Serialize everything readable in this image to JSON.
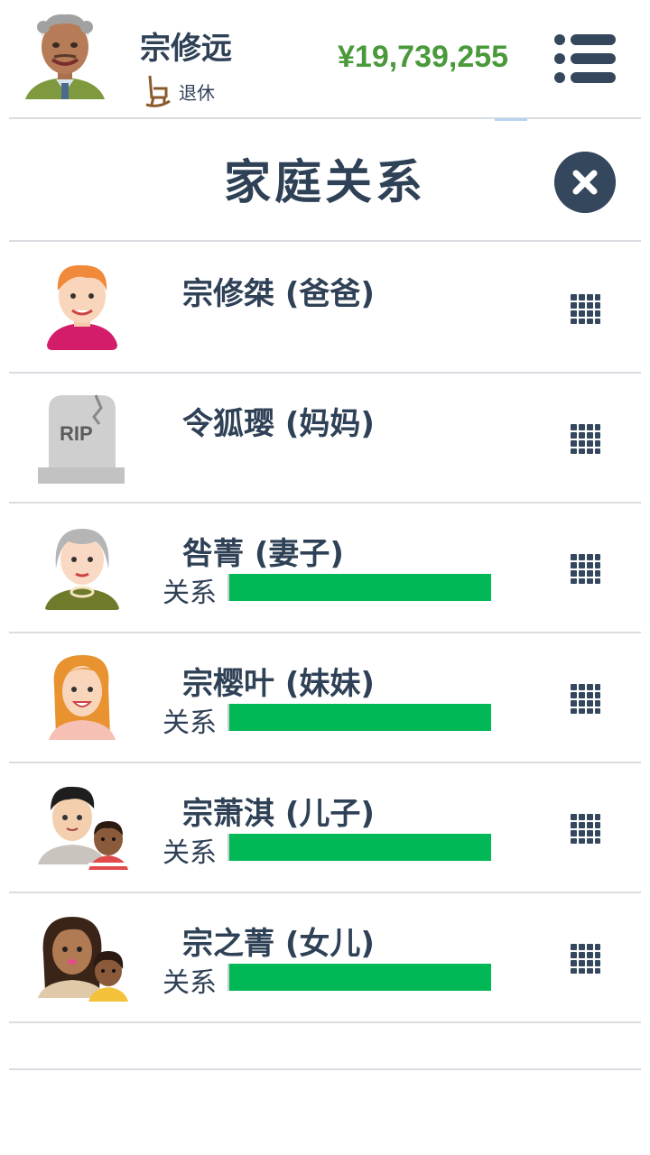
{
  "header": {
    "player_name": "宗修远",
    "status": "退休",
    "money": "¥19,739,255",
    "colors": {
      "money": "#4a9a3b",
      "text": "#2f4156"
    }
  },
  "dialog": {
    "title": "家庭关系",
    "close_icon": "close-icon"
  },
  "relation_label": "关系",
  "members": [
    {
      "name": "宗修桀 (爸爸)",
      "avatar": "redhead-man-avatar",
      "deceased": false,
      "show_relation": false,
      "relation": null
    },
    {
      "name": "令狐璎 (妈妈)",
      "avatar": "rip-tombstone-icon",
      "deceased": true,
      "show_relation": false,
      "relation": null
    },
    {
      "name": "咎菁 (妻子)",
      "avatar": "elderly-woman-avatar",
      "deceased": false,
      "show_relation": true,
      "relation": 1.0
    },
    {
      "name": "宗樱叶 (妹妹)",
      "avatar": "blonde-woman-avatar",
      "deceased": false,
      "show_relation": true,
      "relation": 1.0
    },
    {
      "name": "宗萧淇 (儿子)",
      "avatar": "man-with-child-avatar",
      "deceased": false,
      "show_relation": true,
      "relation": 1.0
    },
    {
      "name": "宗之菁 (女儿)",
      "avatar": "woman-with-child-avatar",
      "deceased": false,
      "show_relation": true,
      "relation": 1.0
    }
  ]
}
